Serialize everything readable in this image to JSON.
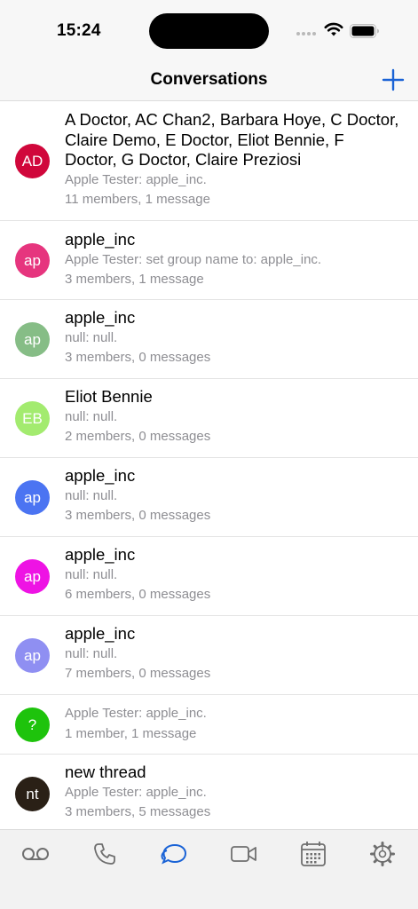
{
  "status_bar": {
    "time": "15:24"
  },
  "nav": {
    "title": "Conversations"
  },
  "colors": {
    "accent": "#1a63d6",
    "secondary_text": "#8e8e93",
    "tab_inactive": "#6f6f6f"
  },
  "conversations": [
    {
      "initials": "AD",
      "color": "#d0073b",
      "title": "A Doctor, AC Chan2, Barbara Hoye, C Doctor, Claire Demo, E Doctor, Eliot Bennie, F Doctor, G Doctor, Claire Preziosi",
      "preview": "Apple Tester: apple_inc.",
      "meta": "11 members, 1 message"
    },
    {
      "initials": "ap",
      "color": "#e6357e",
      "title": "apple_inc",
      "preview": "Apple Tester: set group name to: apple_inc.",
      "meta": "3 members, 1 message"
    },
    {
      "initials": "ap",
      "color": "#86bd86",
      "title": "apple_inc",
      "preview": "null: null.",
      "meta": "3 members, 0 messages"
    },
    {
      "initials": "EB",
      "color": "#a3eb6f",
      "title": "Eliot Bennie",
      "preview": "null: null.",
      "meta": "2 members, 0 messages"
    },
    {
      "initials": "ap",
      "color": "#4b74f2",
      "title": "apple_inc",
      "preview": "null: null.",
      "meta": "3 members, 0 messages"
    },
    {
      "initials": "ap",
      "color": "#ee13e4",
      "title": "apple_inc",
      "preview": "null: null.",
      "meta": "6 members, 0 messages"
    },
    {
      "initials": "ap",
      "color": "#8f8ff2",
      "title": "apple_inc",
      "preview": "null: null.",
      "meta": "7 members, 0 messages"
    },
    {
      "initials": "?",
      "color": "#1ec30c",
      "title": "",
      "preview": "Apple Tester: apple_inc.",
      "meta": "1 member, 1 message"
    },
    {
      "initials": "nt",
      "color": "#2a2016",
      "title": "new thread",
      "preview": "Apple Tester: apple_inc.",
      "meta": "3 members, 5 messages"
    }
  ],
  "tabs": [
    {
      "icon": "voicemail-icon",
      "active": false
    },
    {
      "icon": "phone-icon",
      "active": false
    },
    {
      "icon": "chat-bubbles-icon",
      "active": true
    },
    {
      "icon": "video-icon",
      "active": false
    },
    {
      "icon": "calendar-icon",
      "active": false
    },
    {
      "icon": "settings-gear-icon",
      "active": false
    }
  ]
}
